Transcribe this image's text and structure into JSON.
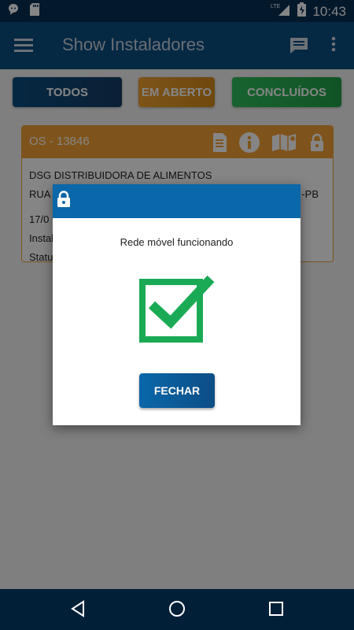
{
  "status_bar": {
    "time": "10:43",
    "network": "LTE",
    "left_icons": [
      "chat-bubble-icon",
      "sd-card-icon"
    ]
  },
  "app_bar": {
    "title": "Show Instaladores"
  },
  "tabs": [
    {
      "label": "TODOS",
      "color": "#0a4d80"
    },
    {
      "label": "EM ABERTO",
      "color": "#f0a030"
    },
    {
      "label": "CONCLUÍDOS",
      "color": "#2fbe5c"
    }
  ],
  "card": {
    "title": "OS - 13846",
    "lines": [
      "DSG DISTRIBUIDORA DE ALIMENTOS",
      "RUA S",
      "-PB",
      "17/0",
      "Instal",
      "Statu"
    ]
  },
  "dialog": {
    "message": "Rede móvel funcionando",
    "button_label": "FECHAR"
  },
  "colors": {
    "primary": "#0a4d80",
    "dialog_header": "#0a67a9",
    "check": "#1aaa55"
  }
}
